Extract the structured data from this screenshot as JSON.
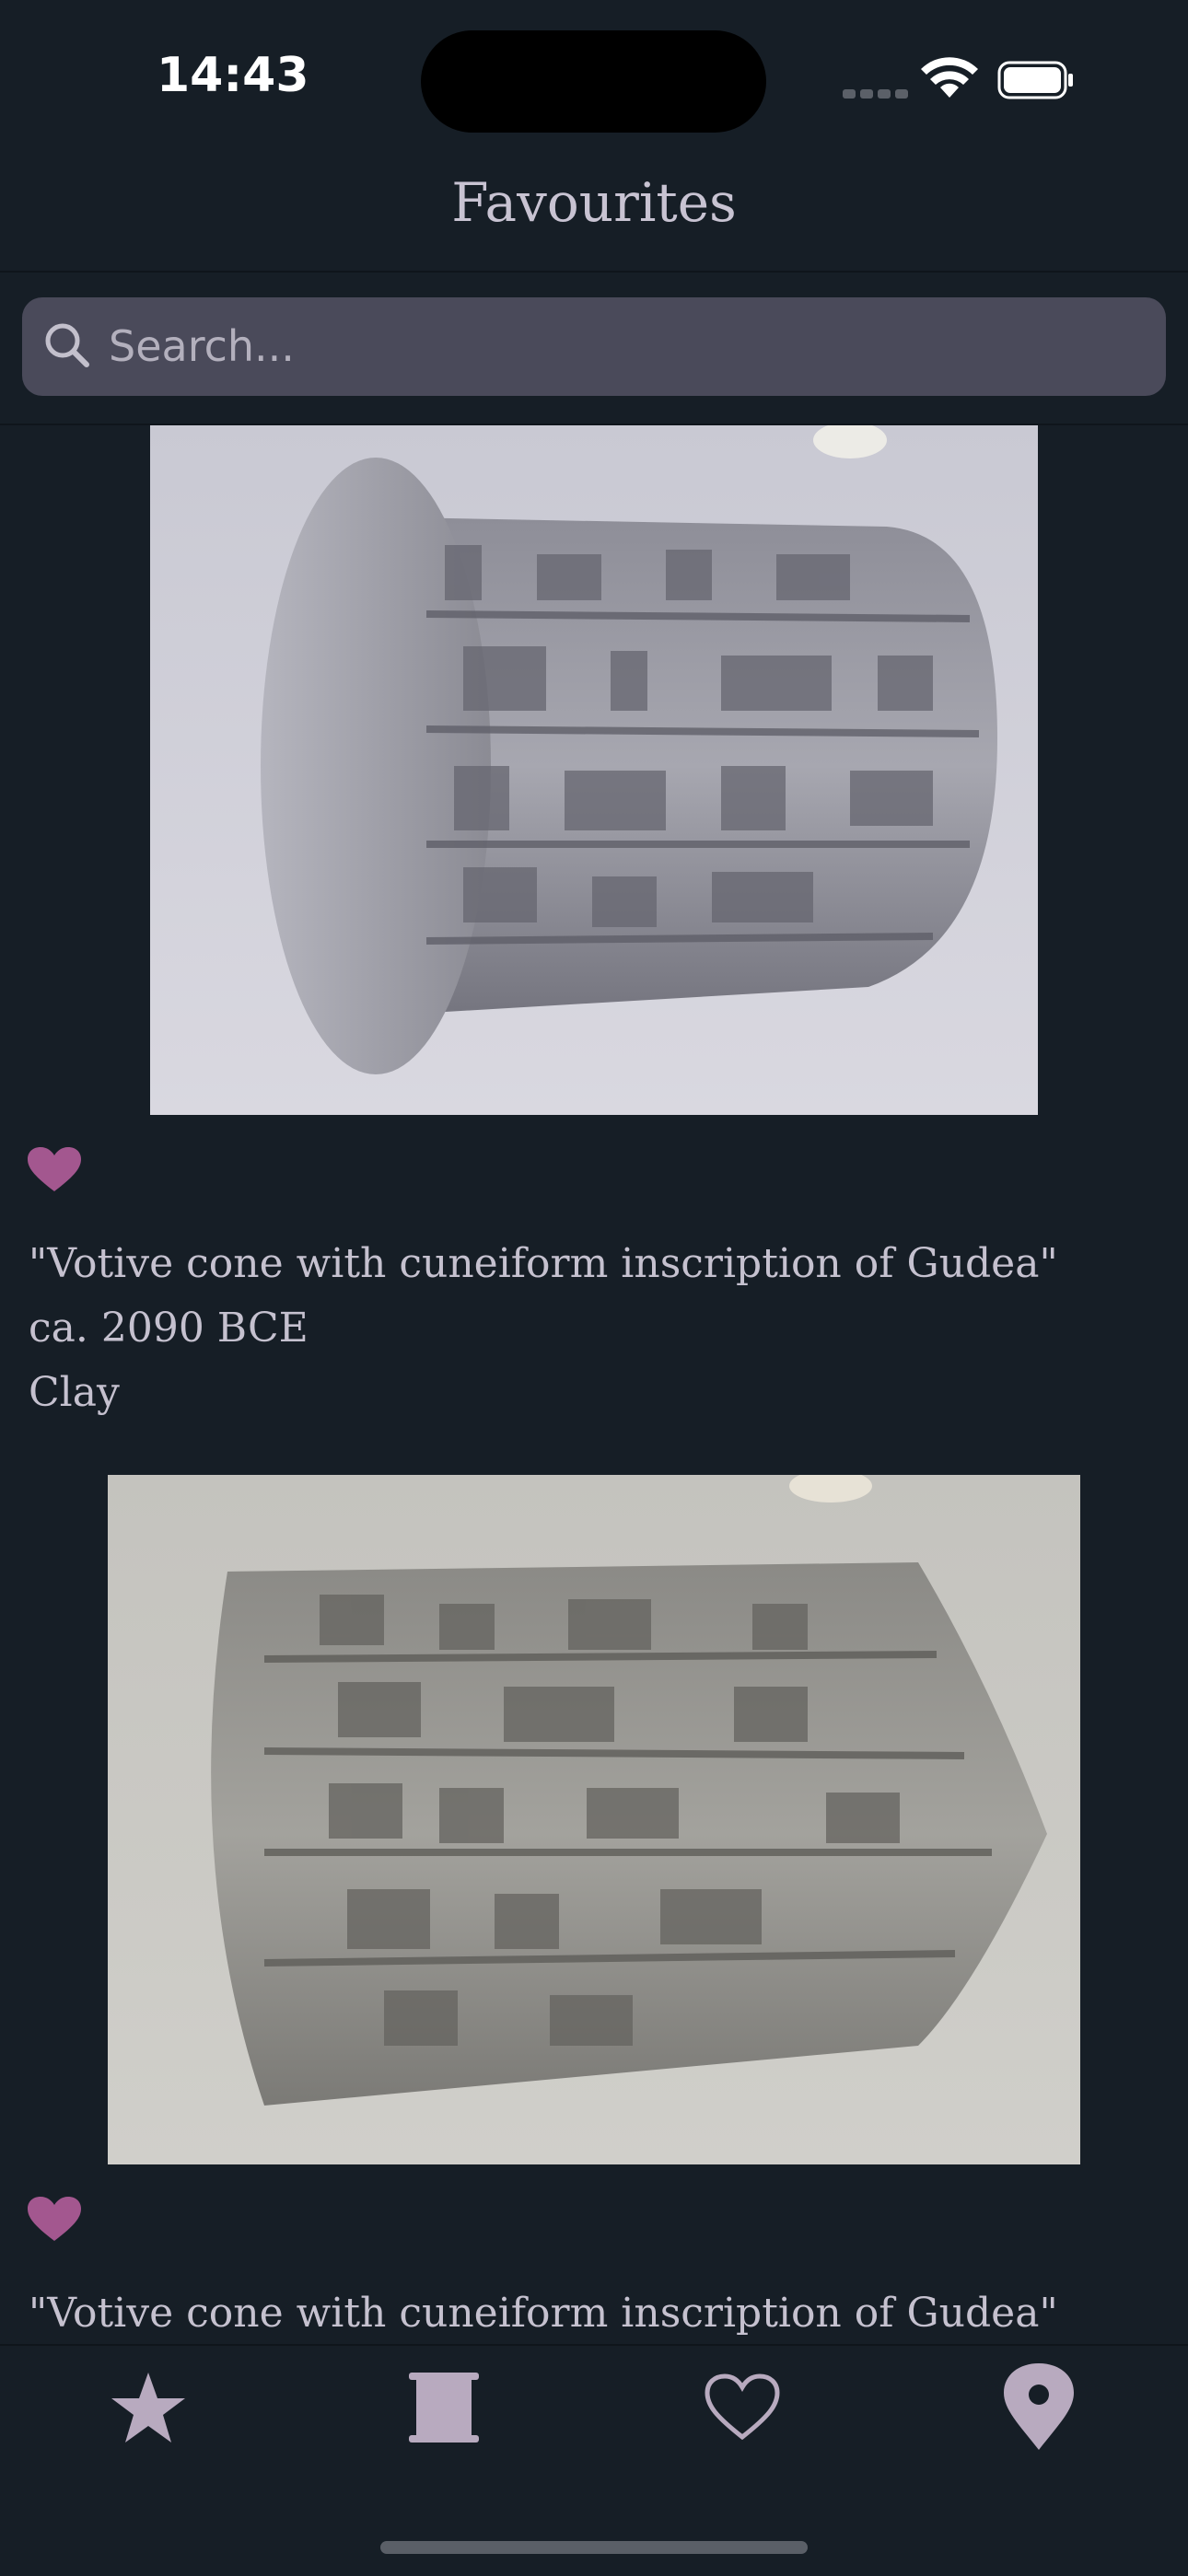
{
  "status": {
    "time": "14:43"
  },
  "header": {
    "title": "Favourites"
  },
  "search": {
    "placeholder": "Search...",
    "value": ""
  },
  "items": [
    {
      "title": "\"Votive cone with cuneiform inscription of Gudea\"",
      "date": "ca. 2090 BCE",
      "material": "Clay",
      "favourite": true
    },
    {
      "title": "\"Votive cone with cuneiform inscription of Gudea\"",
      "favourite": true
    }
  ],
  "tabs": [
    {
      "icon": "star-icon"
    },
    {
      "icon": "scroll-icon"
    },
    {
      "icon": "heart-icon"
    },
    {
      "icon": "location-pin-icon"
    }
  ],
  "colors": {
    "background": "#161e26",
    "heart": "#a3578f",
    "tab_icon": "#b8aabf",
    "search_bg": "#4a4a5a"
  }
}
